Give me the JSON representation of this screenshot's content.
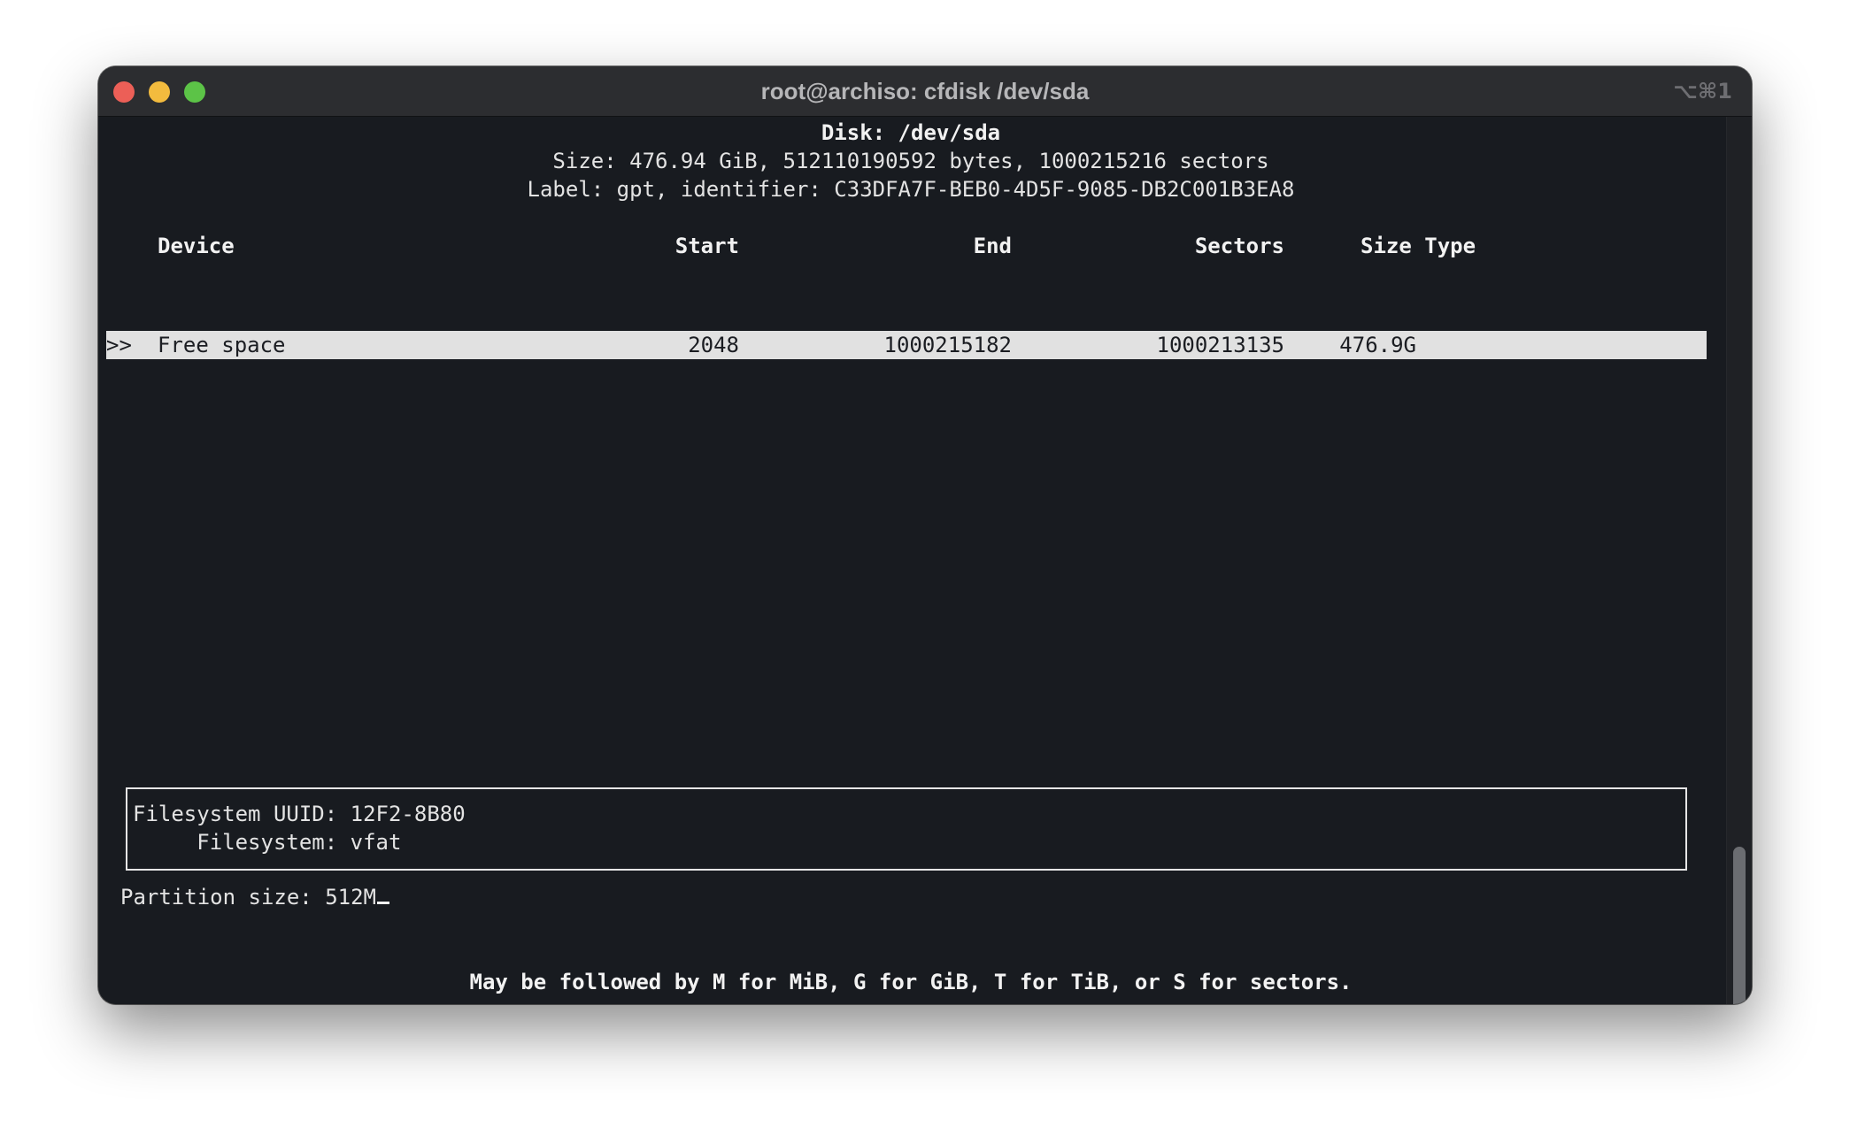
{
  "window": {
    "title": "root@archiso: cfdisk /dev/sda",
    "shortcut": "⌥⌘1"
  },
  "disk": {
    "heading": "Disk: /dev/sda",
    "size_line": "Size: 476.94 GiB, 512110190592 bytes, 1000215216 sectors",
    "label_line": "Label: gpt, identifier: C33DFA7F-BEB0-4D5F-9085-DB2C001B3EA8"
  },
  "table": {
    "headers": {
      "device": "Device",
      "start": "Start",
      "end": "End",
      "sectors": "Sectors",
      "size_type": "Size Type"
    },
    "rows": [
      {
        "marker": ">>",
        "device": "Free space",
        "start": "2048",
        "end": "1000215182",
        "sectors": "1000213135",
        "size": "476.9G"
      }
    ]
  },
  "info_box": {
    "uuid_line": "Filesystem UUID: 12F2-8B80",
    "fs_line": "     Filesystem: vfat"
  },
  "prompt": {
    "label": "Partition size: ",
    "value": "512M"
  },
  "hint": "May be followed by M for MiB, G for GiB, T for TiB, or S for sectors.",
  "colors": {
    "terminal_bg": "#181b20",
    "titlebar_bg": "#2c2d30",
    "selection_bg": "#e1e1e1",
    "text": "#e3e3e3",
    "close": "#ec5f57",
    "minimize": "#f3bb3e",
    "zoom": "#5cc347"
  },
  "icons": {
    "close": "close-circle-icon",
    "minimize": "minimize-circle-icon",
    "zoom": "zoom-circle-icon"
  }
}
